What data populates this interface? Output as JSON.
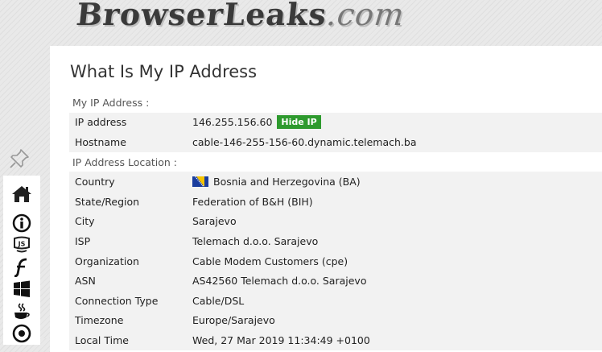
{
  "brand": {
    "logo_text": "BrowserLeaks",
    "logo_domain": ".com"
  },
  "page_title": "What Is My IP Address",
  "sections": {
    "my_ip": "My IP Address :",
    "location": "IP Address Location :"
  },
  "rows": {
    "ip": {
      "label": "IP address",
      "value": "146.255.156.60",
      "button": "Hide IP"
    },
    "hostname": {
      "label": "Hostname",
      "value": "cable-146-255-156-60.dynamic.telemach.ba"
    },
    "country": {
      "label": "Country",
      "value": "Bosnia and Herzegovina (BA)",
      "flag_icon": "flag-ba-icon"
    },
    "state": {
      "label": "State/Region",
      "value": "Federation of B&H (BIH)"
    },
    "city": {
      "label": "City",
      "value": "Sarajevo"
    },
    "isp": {
      "label": "ISP",
      "value": "Telemach d.o.o. Sarajevo"
    },
    "org": {
      "label": "Organization",
      "value": "Cable Modem Customers (cpe)"
    },
    "asn": {
      "label": "ASN",
      "value": "AS42560 Telemach d.o.o. Sarajevo"
    },
    "conn": {
      "label": "Connection Type",
      "value": "Cable/DSL"
    },
    "tz": {
      "label": "Timezone",
      "value": "Europe/Sarajevo"
    },
    "local": {
      "label": "Local Time",
      "value": "Wed, 27 Mar 2019 11:34:49 +0100"
    }
  },
  "nav_icons": [
    "pin-icon",
    "home-icon",
    "info-icon",
    "javascript-icon",
    "flash-icon",
    "windows-icon",
    "java-icon",
    "webrtc-icon"
  ],
  "colors": {
    "hide_button": "#2e9a2e",
    "row_bg": "#f2f2f2",
    "flag_blue": "#1a3d9e",
    "flag_yellow": "#f5c400"
  }
}
